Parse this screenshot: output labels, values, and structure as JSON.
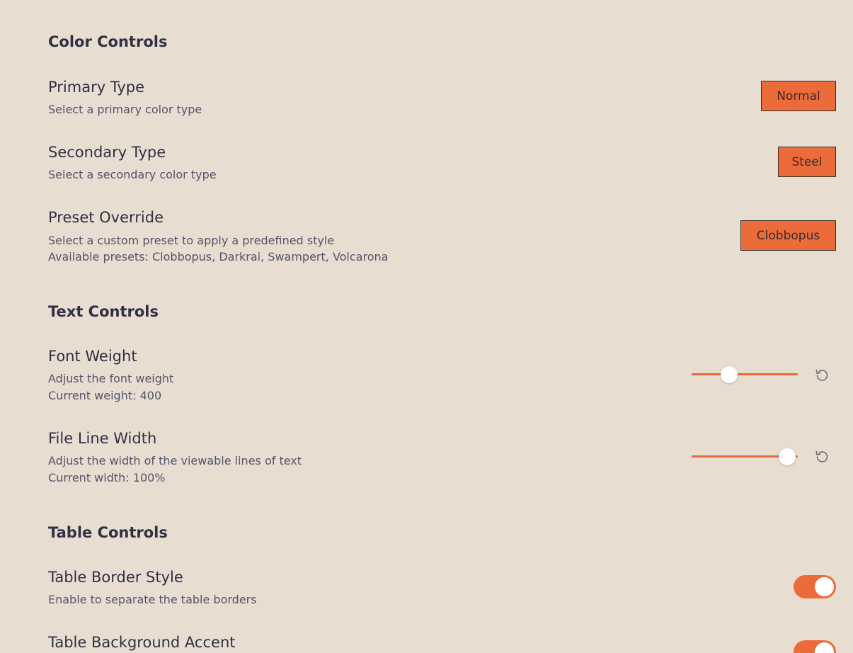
{
  "sections": {
    "color": {
      "heading": "Color Controls",
      "primary": {
        "name": "Primary Type",
        "desc": "Select a primary color type",
        "value": "Normal"
      },
      "secondary": {
        "name": "Secondary Type",
        "desc": "Select a secondary color type",
        "value": "Steel"
      },
      "preset": {
        "name": "Preset Override",
        "desc": "Select a custom preset to apply a predefined style",
        "desc2": "Available presets: Clobbopus, Darkrai, Swampert, Volcarona",
        "value": "Clobbopus"
      }
    },
    "text": {
      "heading": "Text Controls",
      "font_weight": {
        "name": "Font Weight",
        "desc": "Adjust the font weight",
        "desc2": "Current weight: 400",
        "level": 0.35
      },
      "line_width": {
        "name": "File Line Width",
        "desc": "Adjust the width of the viewable lines of text",
        "desc2": "Current width: 100%",
        "level": 0.9
      }
    },
    "table": {
      "heading": "Table Controls",
      "border_style": {
        "name": "Table Border Style",
        "desc": "Enable to separate the table borders",
        "enabled": true
      },
      "background_accent": {
        "name": "Table Background Accent",
        "enabled": true
      }
    }
  },
  "icons": {
    "reset": "reset-icon"
  },
  "colors": {
    "background": "#e8ddd1",
    "accent": "#ec6b3a",
    "text": "#2f3042"
  }
}
